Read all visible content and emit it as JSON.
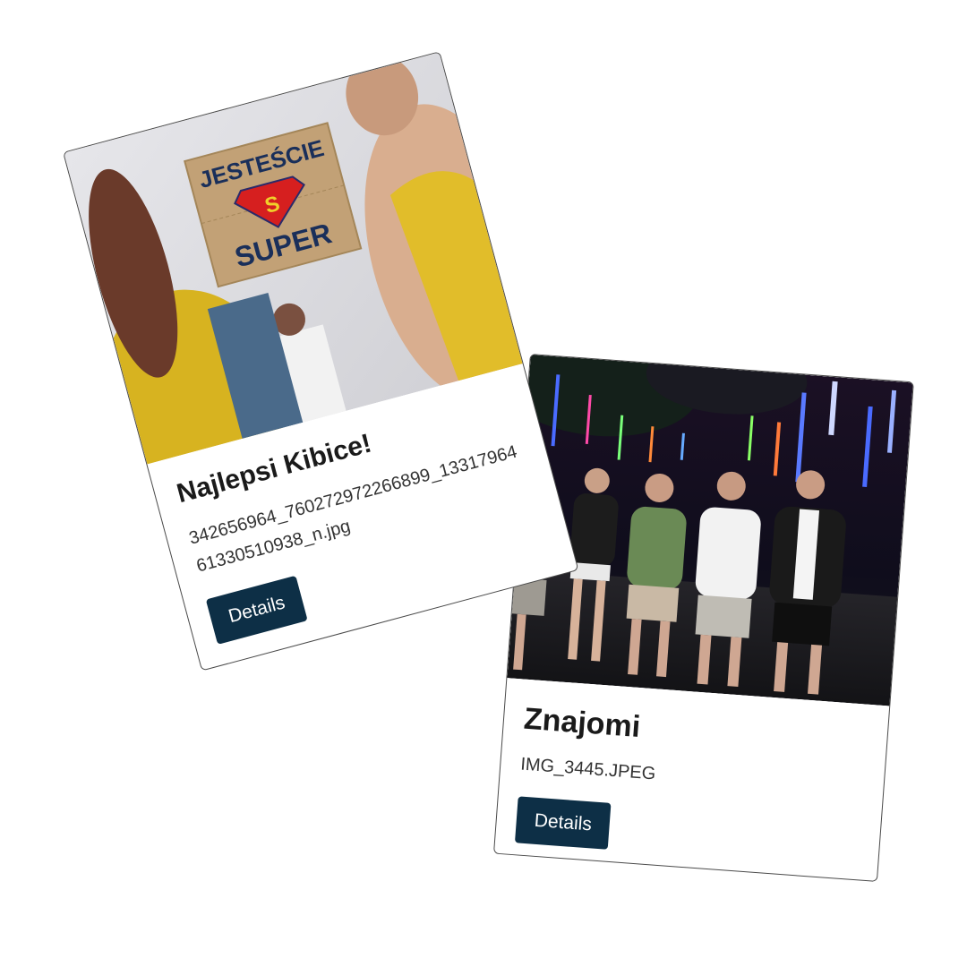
{
  "cards": [
    {
      "title": "Najlepsi Kibice!",
      "filename": "342656964_760272972266899_1331796461330510938_n.jpg",
      "button_label": "Details",
      "sign_text_top": "JESTEŚCIE",
      "sign_text_bottom": "SUPER",
      "sign_emblem": "S"
    },
    {
      "title": "Znajomi",
      "filename": "IMG_3445.JPEG",
      "button_label": "Details"
    }
  ],
  "colors": {
    "button_bg": "#0d2f46",
    "button_text": "#ffffff",
    "card_border": "#4a4a4a"
  }
}
